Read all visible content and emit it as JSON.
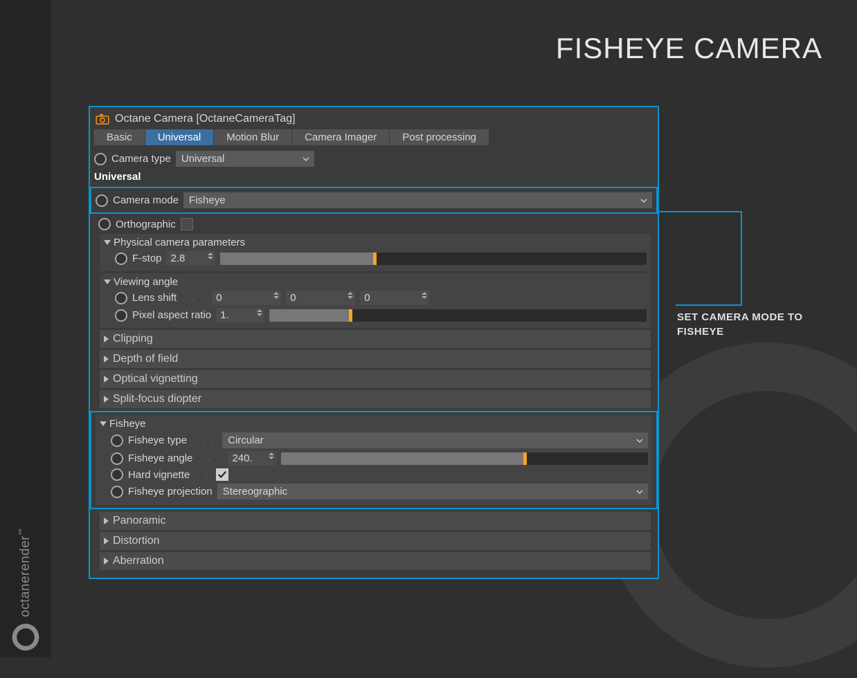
{
  "page": {
    "title": "FISHEYE CAMERA",
    "brand": "octanerender",
    "tm": "™"
  },
  "panel": {
    "header": "Octane Camera [OctaneCameraTag]",
    "tabs": [
      "Basic",
      "Universal",
      "Motion Blur",
      "Camera Imager",
      "Post processing"
    ],
    "active_tab": 1,
    "camera_type": {
      "label": "Camera type",
      "value": "Universal"
    },
    "section": "Universal",
    "camera_mode": {
      "label": "Camera mode",
      "value": "Fisheye"
    },
    "orthographic": {
      "label": "Orthographic",
      "checked": false
    },
    "physical": {
      "title": "Physical camera parameters",
      "fstop": {
        "label": "F-stop",
        "value": "2.8",
        "fill_pct": 36
      }
    },
    "viewing": {
      "title": "Viewing angle",
      "lens_shift": {
        "label": "Lens shift",
        "v1": "0",
        "v2": "0",
        "v3": "0"
      },
      "pixel_aspect": {
        "label": "Pixel aspect ratio",
        "value": "1.",
        "fill_pct": 21
      }
    },
    "collapsed": [
      "Clipping",
      "Depth of field",
      "Optical vignetting",
      "Split-focus diopter"
    ],
    "fisheye": {
      "title": "Fisheye",
      "type": {
        "label": "Fisheye type",
        "value": "Circular"
      },
      "angle": {
        "label": "Fisheye angle",
        "value": "240.",
        "fill_pct": 66
      },
      "hard_vignette": {
        "label": "Hard vignette",
        "checked": true
      },
      "projection": {
        "label": "Fisheye projection",
        "value": "Stereographic"
      }
    },
    "collapsed2": [
      "Panoramic",
      "Distortion",
      "Aberration"
    ]
  },
  "callout": "SET CAMERA MODE TO FISHEYE"
}
